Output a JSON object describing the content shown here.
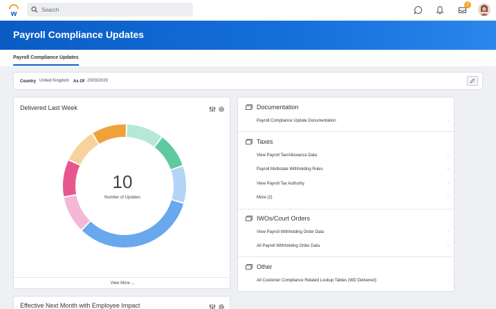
{
  "search": {
    "placeholder": "Search"
  },
  "topbar": {
    "notification_count": "3"
  },
  "header": {
    "title": "Payroll Compliance Updates"
  },
  "tabs": [
    {
      "label": "Payroll Compliance Updates"
    }
  ],
  "filters": {
    "country_label": "Country",
    "country_value": "United Kingdom",
    "asof_label": "As Of",
    "asof_value": "23/03/2020"
  },
  "delivered_card": {
    "title": "Delivered Last Week",
    "count": "10",
    "count_label": "Number of Updates",
    "view_more": "View More ...",
    "segment_colors": [
      "#f0a13a",
      "#b5e8d8",
      "#5fc9a0",
      "#b4d4f6",
      "#6aa8ee",
      "#f4b8d6",
      "#e8568e",
      "#f8d29c"
    ],
    "segment_fractions": [
      0.085,
      0.09,
      0.085,
      0.09,
      0.3,
      0.09,
      0.09,
      0.085
    ]
  },
  "effective_card": {
    "title": "Effective Next Month with Employee Impact"
  },
  "sections": [
    {
      "title": "Documentation",
      "links": [
        "Payroll Compliance Update Documentation"
      ]
    },
    {
      "title": "Taxes",
      "links": [
        "View Payroll Tax/Allowance Data",
        "Payroll Multistate Withholding Rules",
        "View Payroll Tax Authority",
        "More (2)"
      ]
    },
    {
      "title": "IWOs/Court Orders",
      "links": [
        "View Payroll Withholding Order Data",
        "All Payroll Withholding Order Data"
      ]
    },
    {
      "title": "Other",
      "links": [
        "All Customer Compliance Related Lookup Tables (WD Delivered)"
      ]
    }
  ],
  "icons": [
    "workday-logo-icon",
    "search-icon",
    "chat-icon",
    "bell-icon",
    "inbox-icon",
    "avatar",
    "pencil-icon",
    "filter-icon",
    "gear-icon",
    "folder-icon",
    "chevron-right-icon"
  ]
}
